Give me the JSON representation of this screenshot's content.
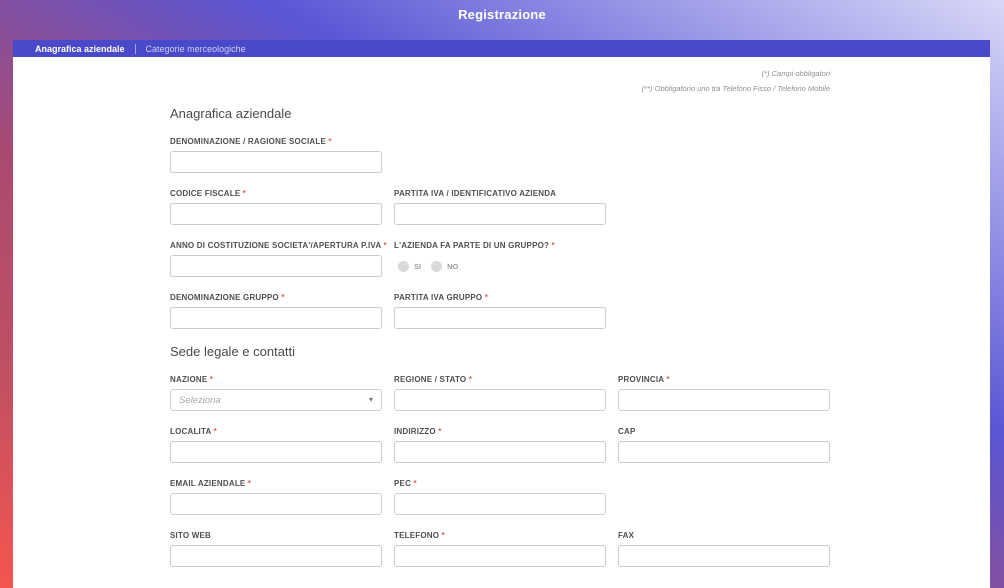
{
  "header": {
    "title": "Registrazione"
  },
  "tabs": [
    {
      "label": "Anagrafica aziendale",
      "active": true
    },
    {
      "label": "Categorie merceologiche",
      "active": false
    }
  ],
  "notes": [
    "(*) Campi obbligatori",
    "(**) Obbligatorio uno tra Telefono Fisso / Telefono Mobile"
  ],
  "form": {
    "sections": [
      {
        "title": "Anagrafica aziendale",
        "rows": [
          [
            {
              "label": "DENOMINAZIONE / RAGIONE SOCIALE",
              "required": true,
              "type": "text",
              "value": ""
            }
          ],
          [
            {
              "label": "CODICE FISCALE",
              "required": true,
              "type": "text",
              "value": ""
            },
            {
              "label": "PARTITA IVA / IDENTIFICATIVO AZIENDA",
              "required": false,
              "type": "text",
              "value": ""
            }
          ],
          [
            {
              "label": "ANNO DI COSTITUZIONE SOCIETA'/APERTURA P.IVA",
              "required": true,
              "type": "text",
              "value": ""
            },
            {
              "label": "L'AZIENDA FA PARTE DI UN GRUPPO?",
              "required": true,
              "type": "radio",
              "options": [
                "SI",
                "NO"
              ],
              "selected": null
            }
          ],
          [
            {
              "label": "DENOMINAZIONE GRUPPO",
              "required": true,
              "type": "text",
              "value": ""
            },
            {
              "label": "PARTITA IVA GRUPPO",
              "required": true,
              "type": "text",
              "value": ""
            }
          ]
        ]
      },
      {
        "title": "Sede legale e contatti",
        "rows": [
          [
            {
              "label": "NAZIONE",
              "required": true,
              "type": "select",
              "placeholder": "Seleziona",
              "value": ""
            },
            {
              "label": "REGIONE / STATO",
              "required": true,
              "type": "text",
              "value": ""
            },
            {
              "label": "PROVINCIA",
              "required": true,
              "type": "text",
              "value": ""
            }
          ],
          [
            {
              "label": "LOCALITA",
              "required": true,
              "type": "text",
              "value": ""
            },
            {
              "label": "INDIRIZZO",
              "required": true,
              "type": "text",
              "value": ""
            },
            {
              "label": "CAP",
              "required": false,
              "type": "text",
              "value": ""
            }
          ],
          [
            {
              "label": "EMAIL AZIENDALE",
              "required": true,
              "type": "text",
              "value": ""
            },
            {
              "label": "PEC",
              "required": true,
              "type": "text",
              "value": ""
            }
          ],
          [
            {
              "label": "SITO WEB",
              "required": false,
              "type": "text",
              "value": ""
            },
            {
              "label": "TELEFONO",
              "required": true,
              "type": "text",
              "value": ""
            },
            {
              "label": "FAX",
              "required": false,
              "type": "text",
              "value": ""
            }
          ]
        ]
      }
    ]
  },
  "colors": {
    "background_gradient": [
      "#f6554e",
      "#aa4a70",
      "#5956d5",
      "#d8d8f8"
    ],
    "tab_bar": "#4a49c9",
    "required_asterisk": "#e25c5c"
  }
}
